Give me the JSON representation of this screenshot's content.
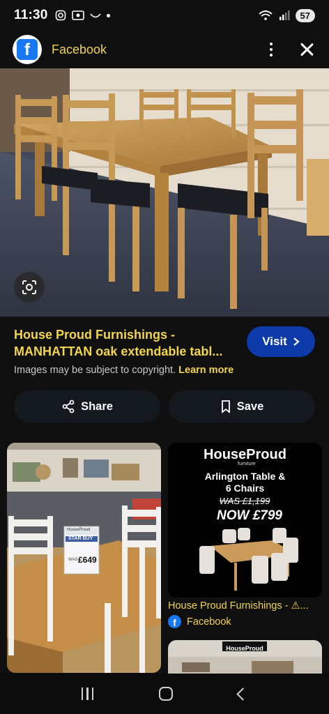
{
  "status": {
    "time": "11:30",
    "battery": "57"
  },
  "header": {
    "source": "Facebook"
  },
  "result": {
    "title_line1": "House Proud Furnishings -",
    "title_line2": "MANHATTAN oak extendable tabl...",
    "visit_label": "Visit",
    "copyright": "Images may be subject to copyright.",
    "learn_more": "Learn more",
    "share_label": "Share",
    "save_label": "Save"
  },
  "related": [
    {
      "price_tag_brand": "HouseProud",
      "price_tag_label": "STAR BUY",
      "price_tag_was": "WAS",
      "price": "£649"
    },
    {
      "brand": "HouseProud",
      "brand_sub": "furniture",
      "headline_line1": "Arlington Table &",
      "headline_line2": "6 Chairs",
      "was_text": "WAS £1,199",
      "now_text": "NOW £799",
      "title": "House Proud Furnishings - ⚠...",
      "source": "Facebook"
    },
    {
      "brand": "HouseProud"
    }
  ]
}
